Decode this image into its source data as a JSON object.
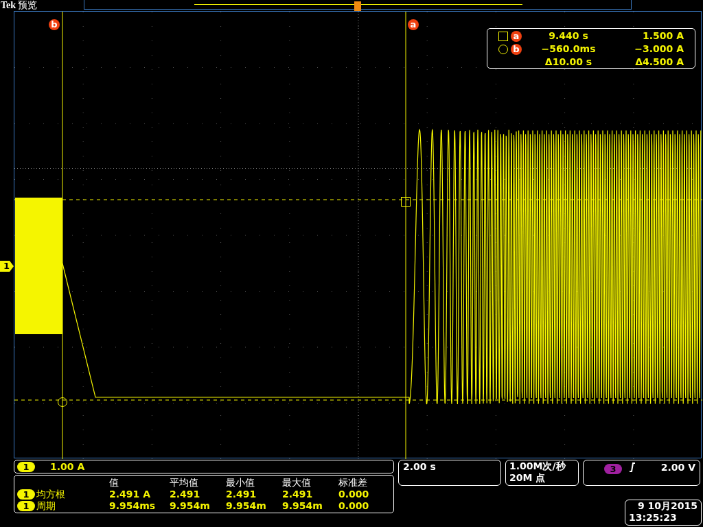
{
  "header": {
    "brand": "Tek",
    "mode": "预览"
  },
  "channel_marker": "1",
  "cursor_labels": [
    {
      "label": "b"
    },
    {
      "label": "a"
    }
  ],
  "cursor_readout": {
    "rows": [
      {
        "kind": "square",
        "label": "a",
        "time": "9.440 s",
        "value": "1.500 A"
      },
      {
        "kind": "circle",
        "label": "b",
        "time": "−560.0ms",
        "value": "−3.000 A"
      }
    ],
    "delta": {
      "time": "Δ10.00 s",
      "value": "Δ4.500 A"
    }
  },
  "channel": {
    "badge": "1",
    "scale": "1.00 A"
  },
  "measurements": {
    "columns": [
      "值",
      "平均值",
      "最小值",
      "最大值",
      "标准差"
    ],
    "rows": [
      {
        "badge": "1",
        "name": "均方根",
        "values": [
          "2.491 A",
          "2.491",
          "2.491",
          "2.491",
          "0.000"
        ]
      },
      {
        "badge": "1",
        "name": "周期",
        "values": [
          "9.954ms",
          "9.954m",
          "9.954m",
          "9.954m",
          "0.000"
        ]
      }
    ]
  },
  "timebase": "2.00 s",
  "acquisition": {
    "rate": "1.00M次/秒",
    "points": "20M 点"
  },
  "trigger": {
    "source": "3",
    "level": "2.00 V"
  },
  "datetime": {
    "date": "9 10月2015",
    "time": "13:25:23"
  }
}
